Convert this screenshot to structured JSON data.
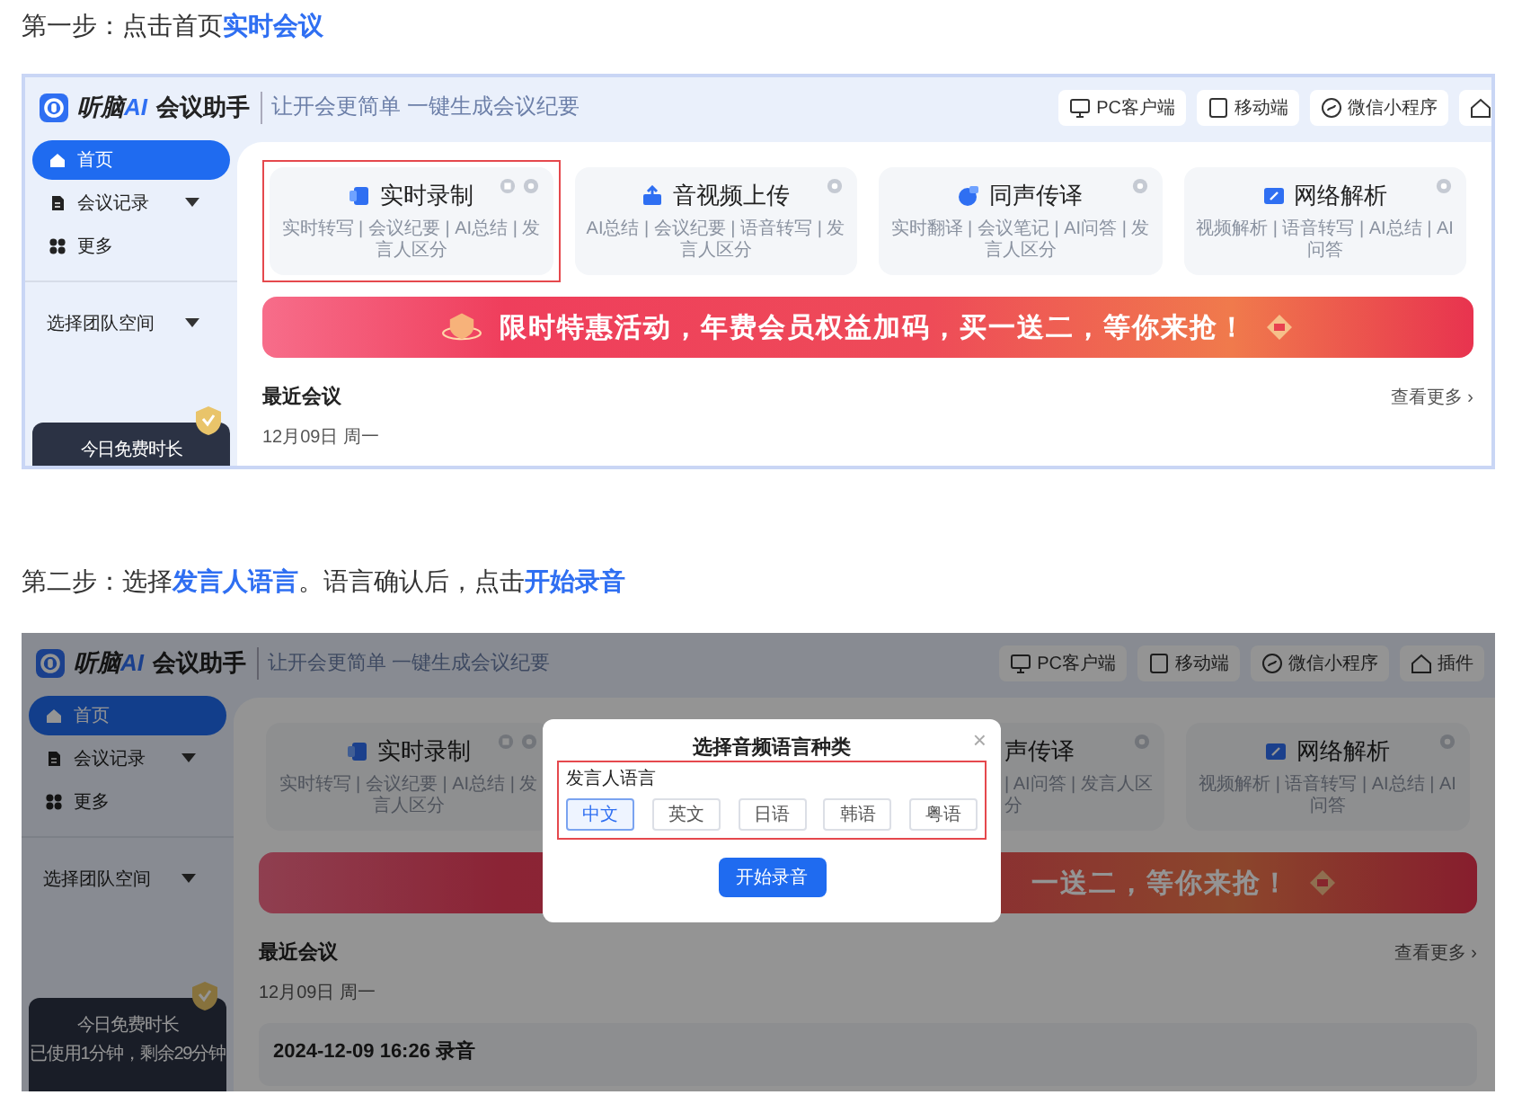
{
  "steps": [
    {
      "instruction": "第一步：点击首页**实时会议**",
      "app": {
        "brand": {
          "name": "听脑",
          "accent": "AI",
          "product": "会议助手",
          "slogan": "让开会更简单 一键生成会议纪要"
        },
        "top_buttons": [
          {
            "label": "PC客户端",
            "kind": "desktop"
          },
          {
            "label": "移动端",
            "kind": "mobile"
          },
          {
            "label": "微信小程序",
            "kind": "miniapp"
          },
          {
            "kind": "plugin"
          }
        ],
        "sidebar": {
          "items": [
            {
              "label": "首页",
              "kind": "home",
              "selected": true,
              "caret": false
            },
            {
              "label": "会议记录",
              "kind": "doc",
              "selected": false,
              "caret": true
            },
            {
              "label": "更多",
              "kind": "grid",
              "selected": false,
              "caret": false
            }
          ],
          "team": "选择团队空间",
          "quota": [
            "今日免费时长"
          ]
        },
        "cards": [
          {
            "title": "实时录制",
            "features": "实时转写 | 会议纪要 | AI总结 | 发言人区分",
            "kind": "record",
            "highlighted": true,
            "clipped": false
          },
          {
            "title": "音视频上传",
            "features": "AI总结 | 会议纪要 | 语音转写 | 发言人区分",
            "kind": "upload",
            "highlighted": false,
            "clipped": false
          },
          {
            "title": "同声传译",
            "features": "实时翻译 | 会议笔记 | AI问答 | 发言人区分",
            "kind": "interpret",
            "highlighted": false,
            "clipped": false
          },
          {
            "title": "网络解析",
            "features": "视频解析 | 语音转写 | AI总结 | AI问答",
            "kind": "web",
            "highlighted": false,
            "clipped": false
          }
        ],
        "banner": {
          "text": "限时特惠活动，年费会员权益加码，买一送二，等你来抢！",
          "clipped": false
        },
        "recent": {
          "title": "最近会议",
          "more": "查看更多 ›",
          "date": "12月09日 周一"
        }
      }
    },
    {
      "instruction": "第二步：选择**发言人语言**。语言确认后，点击**开始录音**",
      "app": {
        "brand": {
          "name": "听脑",
          "accent": "AI",
          "product": "会议助手",
          "slogan": "让开会更简单 一键生成会议纪要"
        },
        "top_buttons": [
          {
            "label": "PC客户端",
            "kind": "desktop"
          },
          {
            "label": "移动端",
            "kind": "mobile"
          },
          {
            "label": "微信小程序",
            "kind": "miniapp"
          },
          {
            "label": "插件",
            "kind": "plugin"
          }
        ],
        "sidebar": {
          "items": [
            {
              "label": "首页",
              "kind": "home",
              "selected": true,
              "caret": false
            },
            {
              "label": "会议记录",
              "kind": "doc",
              "selected": false,
              "caret": true
            },
            {
              "label": "更多",
              "kind": "grid",
              "selected": false,
              "caret": false
            }
          ],
          "team": "选择团队空间",
          "quota": [
            "今日免费时长",
            "已使用1分钟，剩余29分钟"
          ]
        },
        "cards": [
          {
            "title": "实时录制",
            "features": "实时转写 | 会议纪要 | AI总结 | 发言人区分",
            "kind": "record",
            "clipped": false
          },
          {
            "title": "声传译",
            "features": "| AI问答 | 发言人区分",
            "kind": "interpret",
            "clipped": true
          },
          {
            "title": "网络解析",
            "features": "视频解析 | 语音转写 | AI总结 | AI问答",
            "kind": "web",
            "clipped": false
          }
        ],
        "banner": {
          "text": "一送二，等你来抢！",
          "clipped": true
        },
        "recent": {
          "title": "最近会议",
          "more": "查看更多 ›",
          "date": "12月09日 周一",
          "meetings": [
            {
              "title": "2024-12-09 16:26 录音"
            }
          ]
        },
        "dimmed": true,
        "modal": {
          "title": "选择音频语言种类",
          "close": "×",
          "field_label": "发言人语言",
          "highlighted": true,
          "options": [
            {
              "label": "中文",
              "selected": true
            },
            {
              "label": "英文",
              "selected": false
            },
            {
              "label": "日语",
              "selected": false
            },
            {
              "label": "韩语",
              "selected": false
            },
            {
              "label": "粤语",
              "selected": false
            }
          ],
          "action": "开始录音"
        }
      }
    }
  ]
}
